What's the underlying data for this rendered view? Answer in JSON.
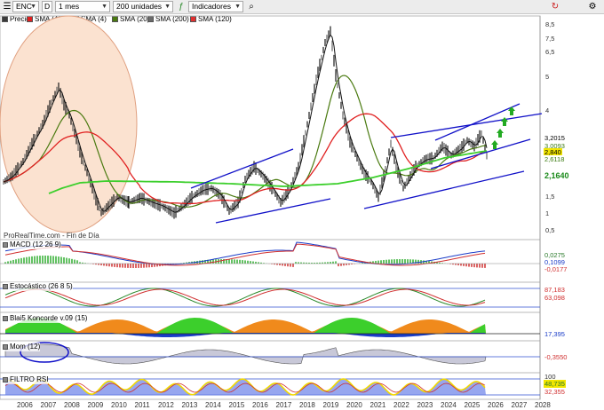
{
  "toolbar": {
    "symbol": "ENC",
    "compare_label": "D",
    "interval": "1 mes",
    "units": "200 unidades",
    "indicators_label": "Indicadores"
  },
  "legend": [
    {
      "label": "Precio",
      "color": "#3a3a3a"
    },
    {
      "label": "SMA (40)",
      "color": "#e02020"
    },
    {
      "label": "SMA (4)",
      "color": "#000000"
    },
    {
      "label": "SMA (20)",
      "color": "#4a7a10"
    },
    {
      "label": "SMA (200)",
      "color": "#6a6a6a"
    },
    {
      "label": "SMA (120)",
      "color": "#e03030"
    }
  ],
  "price_axis": [
    "8,5",
    "7,5",
    "6,5",
    "5",
    "4",
    "3,2015",
    "3,0093",
    "2,840",
    "2,6118",
    "2,1640",
    "1,5",
    "1",
    "0,5"
  ],
  "price_tags": [
    {
      "text": "3,2015",
      "bg": "#ffffff",
      "fg": "#000000"
    },
    {
      "text": "3,0093",
      "bg": "#ffffff",
      "fg": "#3a7a10"
    },
    {
      "text": "2,840",
      "bg": "#f2e600",
      "fg": "#000000"
    },
    {
      "text": "2,6118",
      "bg": "#ffffff",
      "fg": "#3a7a10"
    },
    {
      "text": "2,1640",
      "bg": "#ffffff",
      "fg": "#1a8a1a"
    }
  ],
  "source_label": "ProRealTime.com - Fin de Día",
  "panels": {
    "macd": {
      "title": "MACD (12 26 9)",
      "values": [
        "0,0275",
        "0,1099",
        "-0,0177"
      ]
    },
    "stoch": {
      "title": "Estocástico (26 8 5)",
      "values": [
        "87,183",
        "63,098"
      ]
    },
    "blai": {
      "title": "Blai5 Koncorde v.09 (15)",
      "values": [
        "17,395"
      ]
    },
    "mom": {
      "title": "Mom (12)",
      "values": [
        "-0,3550"
      ]
    },
    "rsi": {
      "title": "FILTRO RSI",
      "values": [
        "100",
        "48,735",
        "32,355"
      ]
    }
  },
  "years": [
    "2006",
    "2007",
    "2008",
    "2009",
    "2010",
    "2011",
    "2012",
    "2013",
    "2014",
    "2015",
    "2016",
    "2017",
    "2018",
    "2019",
    "2020",
    "2021",
    "2022",
    "2023",
    "2024",
    "2025",
    "2026",
    "2027",
    "2028"
  ],
  "colors": {
    "price_line": "#1a1a1a",
    "sma40": "#e02020",
    "sma20": "#4a7a10",
    "sma200": "#3ccf2c",
    "channel": "#1010c8",
    "up_arrow": "#22aa22",
    "ellipse_fill": "#fbe2d0",
    "ellipse_stroke": "#e0a080",
    "macd_pos": "#2fae2f",
    "macd_neg": "#d03030",
    "koncorde_green": "#3ccf2c",
    "koncorde_orange": "#f08a1c",
    "koncorde_blue": "#1a3cc8"
  },
  "icons": [
    "list-icon",
    "magnifier-icon",
    "indicators-icon",
    "refresh-icon",
    "tools-icon"
  ]
}
